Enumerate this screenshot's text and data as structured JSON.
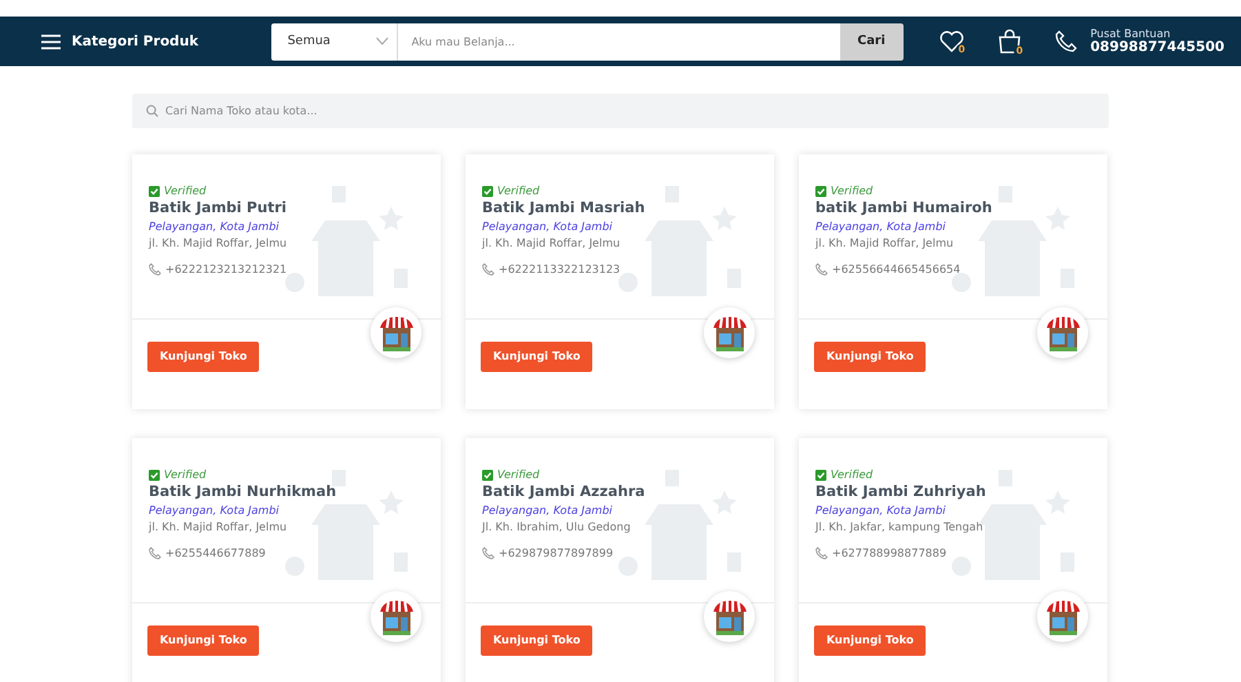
{
  "navbar": {
    "menu_label": "Kategori Produk",
    "category_select": "Semua",
    "search_placeholder": "Aku mau Belanja...",
    "search_button": "Cari",
    "wishlist_count": "0",
    "cart_count": "0",
    "help_title": "Pusat Bantuan",
    "help_phone": "08998877445500"
  },
  "store_search": {
    "placeholder": "Cari Nama Toko atau kota..."
  },
  "stores": [
    {
      "verified": true,
      "verified_label": "Verified",
      "name": "Batik Jambi Putri",
      "location": "Pelayangan, Kota Jambi",
      "address": "jl. Kh. Majid Roffar, Jelmu",
      "phone": "+6222123213212321",
      "button": "Kunjungi Toko"
    },
    {
      "verified": true,
      "verified_label": "Verified",
      "name": "Batik Jambi Masriah",
      "location": "Pelayangan, Kota Jambi",
      "address": "jl. Kh. Majid Roffar, Jelmu",
      "phone": "+6222113322123123",
      "button": "Kunjungi Toko"
    },
    {
      "verified": true,
      "verified_label": "Verified",
      "name": "batik Jambi Humairoh",
      "location": "Pelayangan, Kota Jambi",
      "address": "jl. Kh. Majid Roffar, Jelmu",
      "phone": "+62556644665456654",
      "button": "Kunjungi Toko"
    },
    {
      "verified": true,
      "verified_label": "Verified",
      "name": "Batik Jambi Nurhikmah",
      "location": "Pelayangan, Kota Jambi",
      "address": "jl. Kh. Majid Roffar, Jelmu",
      "phone": "+6255446677889",
      "button": "Kunjungi Toko"
    },
    {
      "verified": true,
      "verified_label": "Verified",
      "name": "Batik Jambi Azzahra",
      "location": "Pelayangan, Kota Jambi",
      "address": "Jl. Kh. Ibrahim, Ulu Gedong",
      "phone": "+629879877897899",
      "button": "Kunjungi Toko"
    },
    {
      "verified": true,
      "verified_label": "Verified",
      "name": "Batik Jambi Zuhriyah",
      "location": "Pelayangan, Kota Jambi",
      "address": "Jl. Kh. Jakfar, kampung Tengah",
      "phone": "+627788998877889",
      "button": "Kunjungi Toko"
    }
  ]
}
